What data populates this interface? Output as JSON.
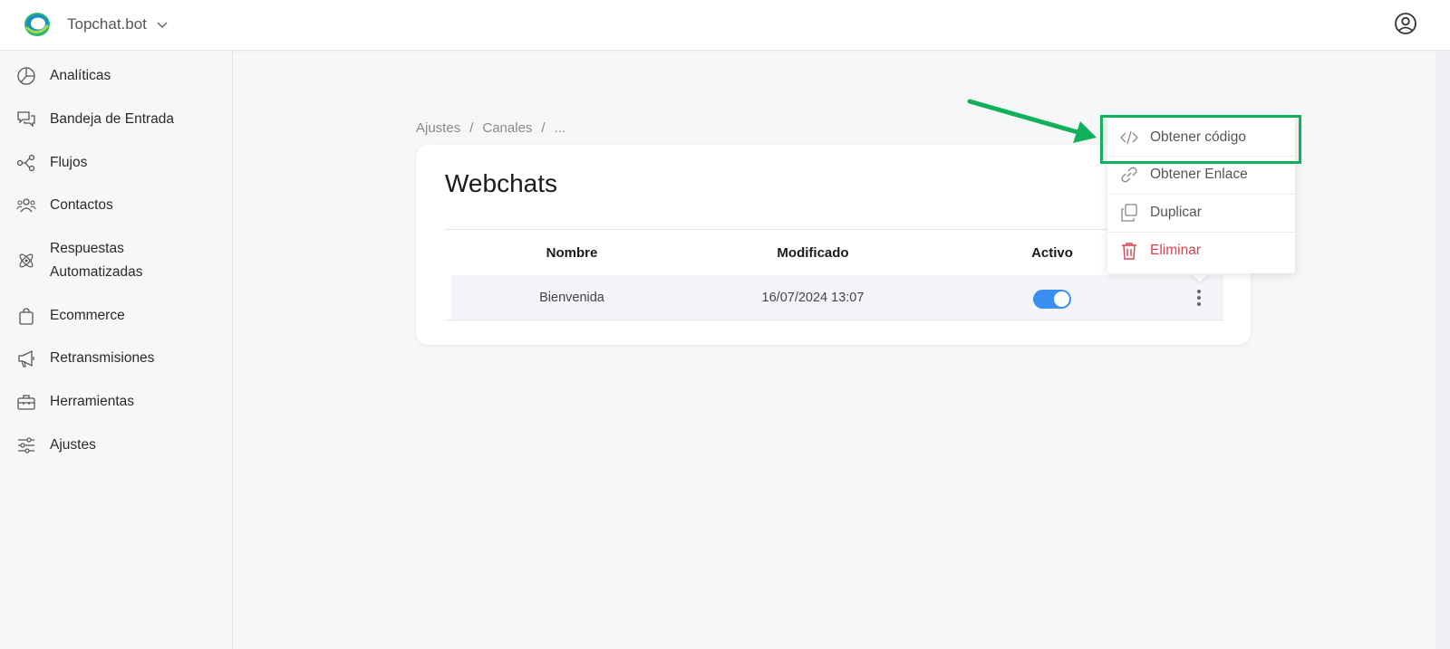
{
  "app": {
    "workspace_name": "Topchat.bot",
    "logo_icon": "topchat-logo",
    "user_icon": "user-circle-icon"
  },
  "sidebar": {
    "items": [
      {
        "label": "Analíticas",
        "icon": "pie-chart-icon"
      },
      {
        "label": "Bandeja de Entrada",
        "icon": "chat-bubbles-icon"
      },
      {
        "label": "Flujos",
        "icon": "share-nodes-icon"
      },
      {
        "label": "Contactos",
        "icon": "users-icon"
      },
      {
        "label": "Respuestas Automatizadas",
        "icon": "atom-icon"
      },
      {
        "label": "Ecommerce",
        "icon": "shopping-bag-icon"
      },
      {
        "label": "Retransmisiones",
        "icon": "megaphone-icon"
      },
      {
        "label": "Herramientas",
        "icon": "toolbox-icon"
      },
      {
        "label": "Ajustes",
        "icon": "sliders-icon"
      }
    ]
  },
  "breadcrumb": {
    "items": [
      "Ajustes",
      "Canales",
      "..."
    ],
    "separator": "/"
  },
  "card": {
    "title": "Webchats",
    "table": {
      "headers": [
        "Nombre",
        "Modificado",
        "Activo"
      ],
      "rows": [
        {
          "nombre": "Bienvenida",
          "modificado": "16/07/2024 13:07",
          "activo": true
        }
      ]
    }
  },
  "menu": {
    "items": [
      {
        "label": "Obtener código",
        "icon": "code-icon"
      },
      {
        "label": "Obtener Enlace",
        "icon": "link-icon"
      },
      {
        "label": "Duplicar",
        "icon": "copy-icon"
      },
      {
        "label": "Eliminar",
        "icon": "trash-icon"
      }
    ]
  },
  "colors": {
    "accent": "#3b8ff0",
    "danger": "#d9414d",
    "highlight": "#11b05a"
  }
}
